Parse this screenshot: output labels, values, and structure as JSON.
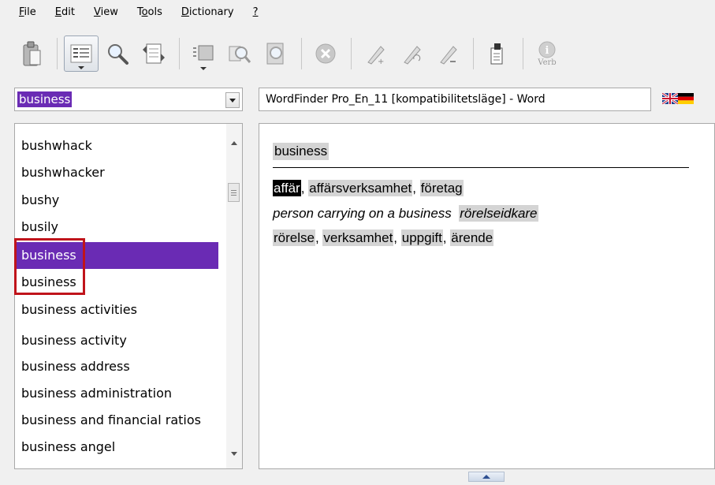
{
  "menu": [
    {
      "label": "File"
    },
    {
      "label": "Edit"
    },
    {
      "label": "View"
    },
    {
      "label": "Tools"
    },
    {
      "label": "Dictionary"
    },
    {
      "label": "?"
    }
  ],
  "toolbar": {
    "buttons": [
      "paste-icon",
      "list-view-icon",
      "search-icon",
      "swap-language-icon",
      "document-view-icon",
      "find-in-document-icon",
      "zoom-document-icon",
      "stop-icon",
      "add-word-icon",
      "edit-word-icon",
      "remove-word-icon",
      "usage-icon",
      "verb-info-icon"
    ],
    "verb_label": "Verb"
  },
  "search": {
    "value": "business"
  },
  "document": {
    "title": "WordFinder Pro_En_11 [kompatibilitetsläge] - Word"
  },
  "wordlist": {
    "items": [
      "bushwhack",
      "bushwhacker",
      "bushy",
      "busily",
      "business",
      "business",
      "business activities",
      "business activity",
      "business address",
      "business administration",
      "business and financial ratios",
      "business angel"
    ],
    "selected_index": 4
  },
  "translation": {
    "headword": "business",
    "line1": [
      "affär",
      "affärsverksamhet",
      "företag"
    ],
    "phrase": "person carrying on a business",
    "phrase_translation": "rörelseidkare",
    "line3": [
      "rörelse",
      "verksamhet",
      "uppgift",
      "ärende"
    ],
    "separator": ", "
  },
  "colors": {
    "selection": "#6a2bb4",
    "highlight_box": "#c0141b",
    "word_bg": "#d4d4d4"
  }
}
